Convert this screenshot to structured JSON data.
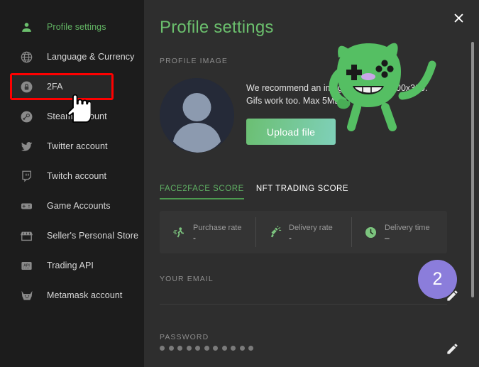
{
  "sidebar": {
    "items": [
      {
        "label": "Profile settings",
        "icon": "person-icon",
        "active": true
      },
      {
        "label": "Language & Currency",
        "icon": "globe-icon",
        "active": false
      },
      {
        "label": "2FA",
        "icon": "lock-icon",
        "active": false
      },
      {
        "label": "Steam account",
        "icon": "steam-icon",
        "active": false
      },
      {
        "label": "Twitter account",
        "icon": "twitter-icon",
        "active": false
      },
      {
        "label": "Twitch account",
        "icon": "twitch-icon",
        "active": false
      },
      {
        "label": "Game Accounts",
        "icon": "gamepad-icon",
        "active": false
      },
      {
        "label": "Seller's Personal Store",
        "icon": "store-icon",
        "active": false
      },
      {
        "label": "Trading API",
        "icon": "api-icon",
        "active": false
      },
      {
        "label": "Metamask account",
        "icon": "metamask-icon",
        "active": false
      }
    ],
    "highlighted_item": "2FA"
  },
  "main": {
    "title": "Profile settings",
    "close_label": "✕",
    "profile_image": {
      "section_label": "PROFILE IMAGE",
      "recommendation": "We recommend an image of at least 300x300. Gifs work too. Max 5MB.",
      "upload_label": "Upload file"
    },
    "tabs": [
      {
        "label": "FACE2FACE SCORE",
        "active": true
      },
      {
        "label": "NFT TRADING SCORE",
        "active": false
      }
    ],
    "scores": [
      {
        "name": "Purchase rate",
        "value": "-",
        "icon": "runner-icon"
      },
      {
        "name": "Delivery rate",
        "value": "-",
        "icon": "delivery-icon"
      },
      {
        "name": "Delivery time",
        "value": "–",
        "icon": "clock-icon"
      }
    ],
    "email": {
      "section_label": "YOUR EMAIL",
      "value": ""
    },
    "password": {
      "section_label": "PASSWORD",
      "masked_value": "●●●●●●●●●●●",
      "dot_count": 11
    }
  },
  "overlay": {
    "step_badge": "2",
    "step_badge_color": "#8b7ddb",
    "highlight_color": "#fe0000",
    "cursor": "pointing-hand"
  },
  "colors": {
    "sidebar_bg": "#1c1c1c",
    "main_bg": "#2e2e2e",
    "accent_green": "#6bbf6d",
    "card_bg": "#343434"
  }
}
